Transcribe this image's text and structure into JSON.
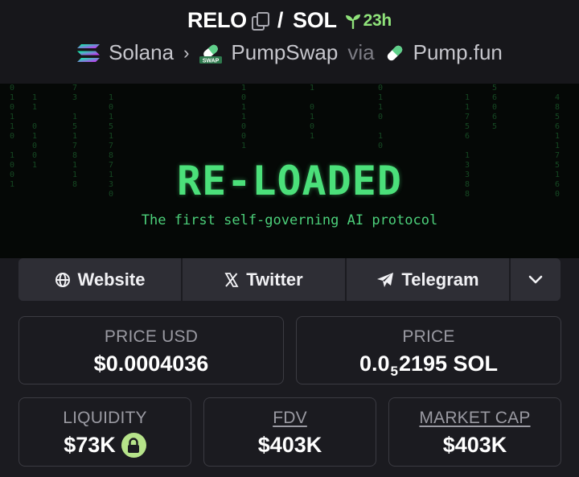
{
  "header": {
    "base_token": "RELO",
    "separator": "/",
    "quote_token": "SOL",
    "age": "23h",
    "chain": "Solana",
    "dex": "PumpSwap",
    "via_label": "via",
    "launchpad": "Pump.fun",
    "colors": {
      "age": "#8fe27a"
    }
  },
  "banner": {
    "title": "RE-LOADED",
    "subtitle": "The first self-governing AI protocol",
    "color": "#4be07a"
  },
  "links": {
    "website": "Website",
    "twitter": "Twitter",
    "telegram": "Telegram"
  },
  "stats": {
    "price_usd_label": "PRICE USD",
    "price_usd": "$0.0004036",
    "price_label": "PRICE",
    "price_prefix": "0.0",
    "price_zero_count": "5",
    "price_suffix": "2195 SOL",
    "liquidity_label": "LIQUIDITY",
    "liquidity": "$73K",
    "fdv_label": "FDV",
    "fdv": "$403K",
    "mcap_label": "MARKET CAP",
    "mcap": "$403K"
  }
}
